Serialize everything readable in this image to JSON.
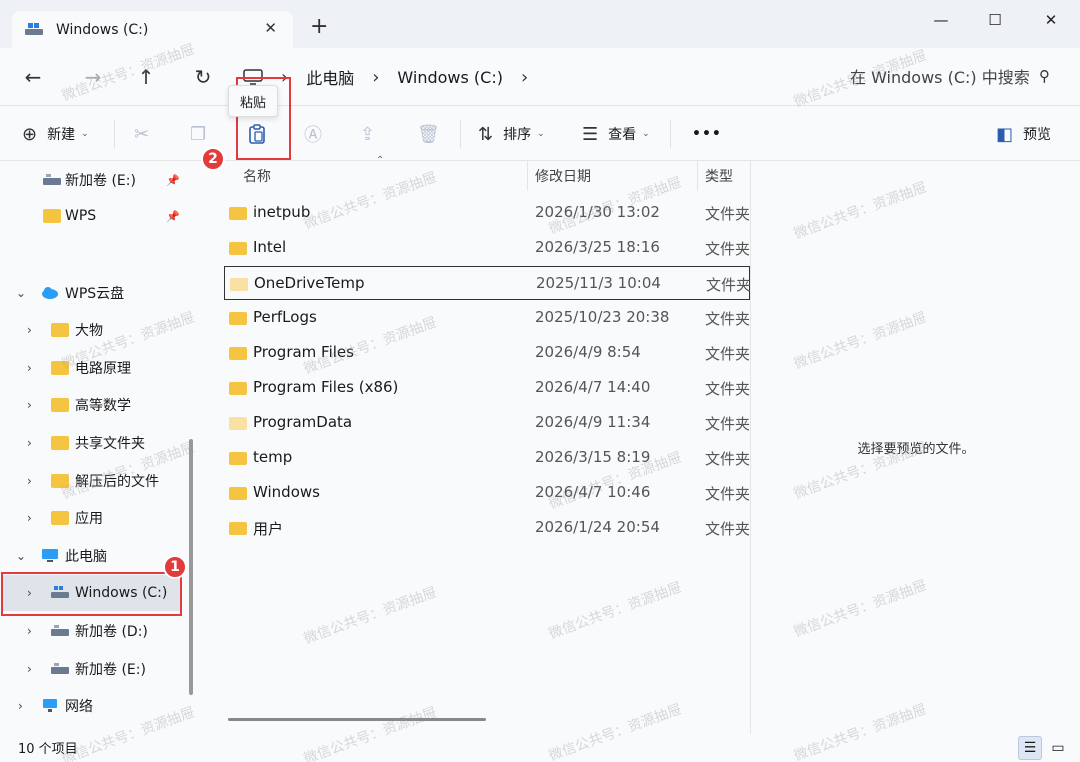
{
  "window": {
    "tab_title": "Windows (C:)",
    "tab_close": "✕",
    "new_tab": "+",
    "minimize": "—",
    "maximize": "☐",
    "close": "✕"
  },
  "nav": {
    "back": "←",
    "forward": "→",
    "up": "↑",
    "refresh": "↻"
  },
  "breadcrumb": {
    "items": [
      "此电脑",
      "Windows (C:)"
    ],
    "separator": "›"
  },
  "search": {
    "placeholder": "在 Windows (C:) 中搜索"
  },
  "toolbar": {
    "new_label": "新建",
    "sort_label": "排序",
    "view_label": "查看",
    "more_label": "•••",
    "preview_label": "预览",
    "tooltip": "粘贴"
  },
  "sidebar": {
    "items": [
      {
        "label": "新加卷 (E:)",
        "icon": "drive-icon",
        "pinned": true
      },
      {
        "label": "WPS",
        "icon": "folder-icon",
        "pinned": true
      },
      {
        "label": "WPS云盘",
        "icon": "cloud-icon"
      },
      {
        "label": "大物",
        "icon": "folder-icon"
      },
      {
        "label": "电路原理",
        "icon": "folder-icon"
      },
      {
        "label": "高等数学",
        "icon": "folder-icon"
      },
      {
        "label": "共享文件夹",
        "icon": "shared-folder-icon"
      },
      {
        "label": "解压后的文件",
        "icon": "folder-icon"
      },
      {
        "label": "应用",
        "icon": "app-folder-icon"
      },
      {
        "label": "此电脑",
        "icon": "computer-icon"
      },
      {
        "label": "Windows (C:)",
        "icon": "drive-icon"
      },
      {
        "label": "新加卷 (D:)",
        "icon": "drive-icon"
      },
      {
        "label": "新加卷 (E:)",
        "icon": "drive-icon"
      },
      {
        "label": "网络",
        "icon": "network-icon"
      }
    ]
  },
  "columns": {
    "name": "名称",
    "date": "修改日期",
    "type": "类型"
  },
  "files": [
    {
      "name": "inetpub",
      "date": "2026/1/30 13:02",
      "type": "文件夹"
    },
    {
      "name": "Intel",
      "date": "2026/3/25 18:16",
      "type": "文件夹"
    },
    {
      "name": "OneDriveTemp",
      "date": "2025/11/3 10:04",
      "type": "文件夹"
    },
    {
      "name": "PerfLogs",
      "date": "2025/10/23 20:38",
      "type": "文件夹"
    },
    {
      "name": "Program Files",
      "date": "2026/4/9 8:54",
      "type": "文件夹"
    },
    {
      "name": "Program Files (x86)",
      "date": "2026/4/7 14:40",
      "type": "文件夹"
    },
    {
      "name": "ProgramData",
      "date": "2026/4/9 11:34",
      "type": "文件夹"
    },
    {
      "name": "temp",
      "date": "2026/3/15 8:19",
      "type": "文件夹"
    },
    {
      "name": "Windows",
      "date": "2026/4/7 10:46",
      "type": "文件夹"
    },
    {
      "name": "用户",
      "date": "2026/1/24 20:54",
      "type": "文件夹"
    }
  ],
  "preview": {
    "message": "选择要预览的文件。"
  },
  "status": {
    "count": "10 个项目"
  },
  "annotations": {
    "step1": "1",
    "step2": "2"
  },
  "watermark": "微信公共号：资源抽屉",
  "colors": {
    "accent": "#2a5db0",
    "highlight": "#e23b3b",
    "folder": "#f5c542"
  }
}
